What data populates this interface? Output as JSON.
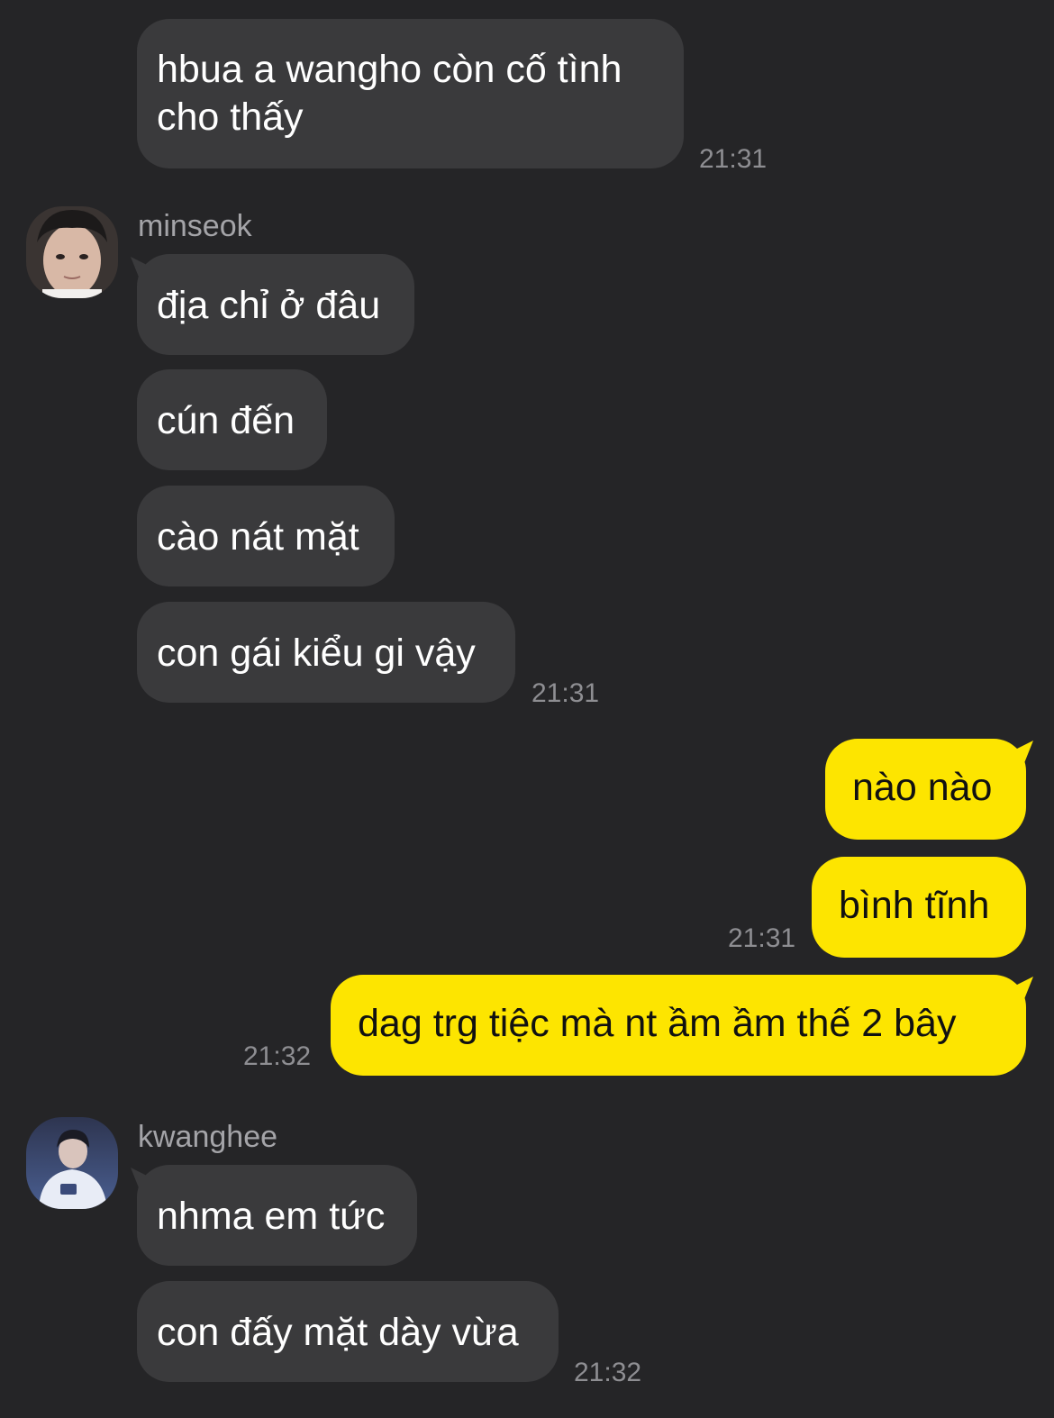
{
  "messages": [
    {
      "text": "hbua a wangho còn cố tình cho thấy",
      "time": "21:31"
    },
    {
      "sender": "minseok",
      "text": "địa chỉ ở đâu"
    },
    {
      "text": "cún đến"
    },
    {
      "text": "cào nát mặt"
    },
    {
      "text": "con gái kiểu gi vậy",
      "time": "21:31"
    },
    {
      "text": "nào nào"
    },
    {
      "text": "bình tĩnh",
      "time": "21:31"
    },
    {
      "text": "dag trg tiệc mà nt ầm ầm thế 2 bây",
      "time": "21:32"
    },
    {
      "sender": "kwanghee",
      "text": "nhma em tức"
    },
    {
      "text": "con đấy mặt dày vừa",
      "time": "21:32"
    }
  ],
  "colors": {
    "background": "#252527",
    "incoming_bubble": "#3a3a3c",
    "outgoing_bubble": "#fde500"
  }
}
